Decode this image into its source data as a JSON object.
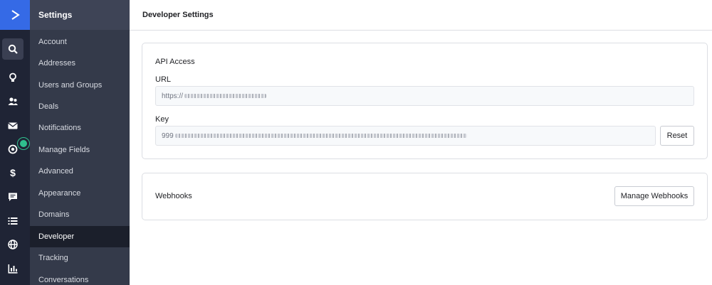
{
  "nav": {
    "header": "Settings",
    "items": [
      "Account",
      "Addresses",
      "Users and Groups",
      "Deals",
      "Notifications",
      "Manage Fields",
      "Advanced",
      "Appearance",
      "Domains",
      "Developer",
      "Tracking",
      "Conversations"
    ],
    "active": "Developer"
  },
  "page": {
    "title": "Developer Settings"
  },
  "api": {
    "section_title": "API Access",
    "url_label": "URL",
    "url_value_prefix": "https://",
    "key_label": "Key",
    "key_value_prefix": "999",
    "reset_label": "Reset"
  },
  "webhooks": {
    "title": "Webhooks",
    "manage_label": "Manage Webhooks"
  },
  "colors": {
    "brand": "#356ae6",
    "rail": "#1f2435",
    "nav": "#343a4a",
    "nav_active": "#1b1f2b",
    "badge": "#2fc08e"
  },
  "rail_icons": [
    "search-icon",
    "lightbulb-icon",
    "contacts-icon",
    "mail-icon",
    "automation-icon",
    "dollar-icon",
    "chat-icon",
    "list-icon",
    "globe-icon",
    "reports-icon"
  ]
}
